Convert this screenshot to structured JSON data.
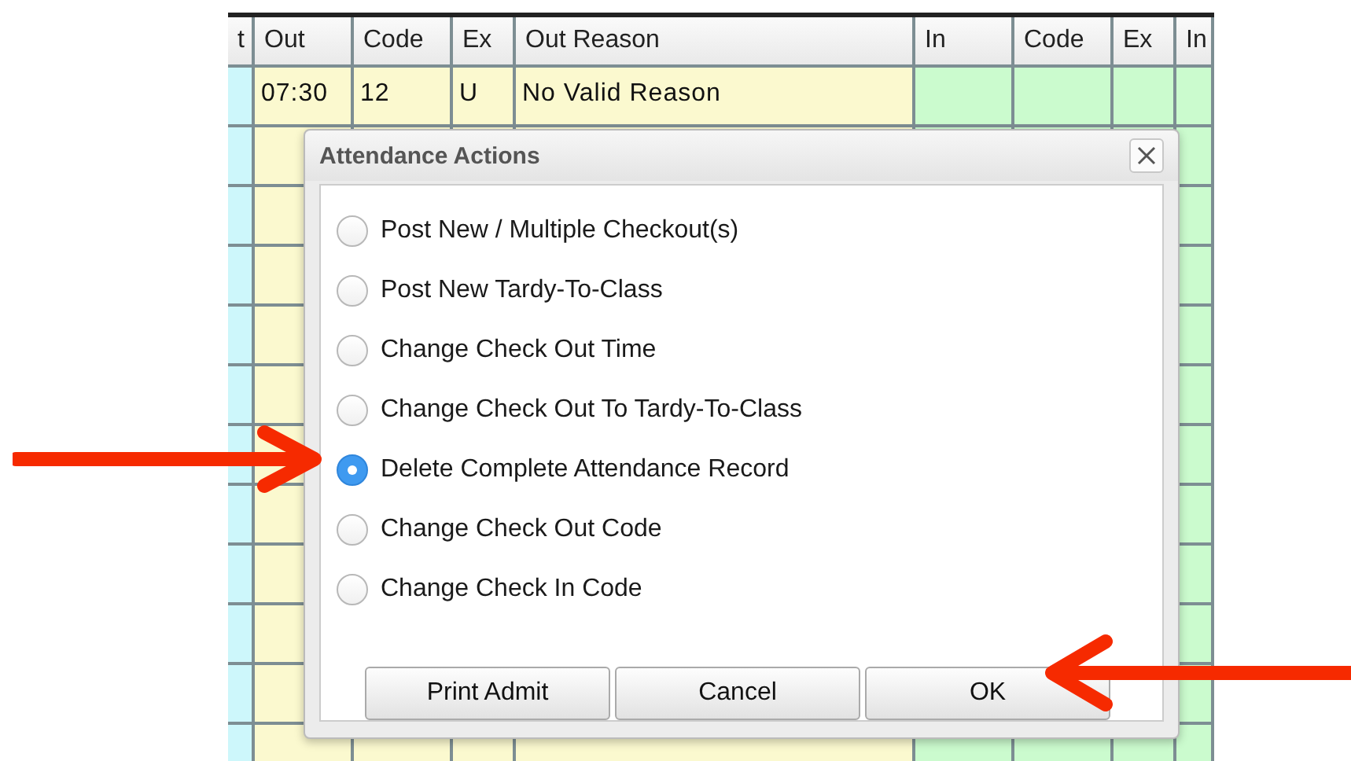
{
  "table": {
    "columns": [
      {
        "label": "t",
        "kind": "info"
      },
      {
        "label": "Out",
        "kind": "out",
        "cells": [
          "07:30"
        ]
      },
      {
        "label": "Code",
        "kind": "out",
        "cells": [
          "12"
        ]
      },
      {
        "label": "Ex",
        "kind": "out",
        "cells": [
          "U"
        ]
      },
      {
        "label": "Out Reason",
        "kind": "out",
        "cells": [
          "No Valid Reason"
        ]
      },
      {
        "label": "In",
        "kind": "in"
      },
      {
        "label": "Code",
        "kind": "in"
      },
      {
        "label": "Ex",
        "kind": "in"
      },
      {
        "label": "In",
        "kind": "in"
      }
    ]
  },
  "dialog": {
    "title": "Attendance Actions",
    "options": [
      {
        "label": "Post New / Multiple Checkout(s)",
        "selected": false
      },
      {
        "label": "Post New Tardy-To-Class",
        "selected": false
      },
      {
        "label": "Change Check Out Time",
        "selected": false
      },
      {
        "label": "Change Check Out To Tardy-To-Class",
        "selected": false
      },
      {
        "label": "Delete Complete Attendance Record",
        "selected": true
      },
      {
        "label": "Change Check Out Code",
        "selected": false
      },
      {
        "label": "Change Check In Code",
        "selected": false
      }
    ],
    "buttons": [
      "Print Admit",
      "Cancel",
      "OK"
    ]
  }
}
